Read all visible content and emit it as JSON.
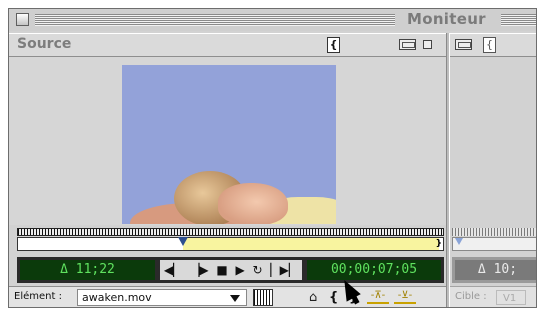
{
  "window": {
    "title": "Moniteur"
  },
  "source": {
    "title": "Source",
    "bracket_icon": "{",
    "duration": "Δ 11;22",
    "timecode": "00;00;07;05",
    "end_marker": "}",
    "clip_label": "Elément :",
    "clip_value": "awaken.mov",
    "mark_in": "⌂",
    "mark_bracket_in": "{",
    "mark_bracket_out": "}",
    "lift_icon": "-⊼-",
    "extract_icon": "-⊻-"
  },
  "transport": {
    "step_back": "◀▏",
    "step_fwd": "▕▶",
    "stop": "■",
    "play": "▶",
    "loop": "↻",
    "play_in_out": "▏▶▏"
  },
  "program": {
    "bracket_icon": "{",
    "duration": "Δ 10;",
    "target_label": "Cible :",
    "target_value": "V1"
  },
  "colors": {
    "timecode_bg": "#0b3a0b",
    "timecode_fg": "#5fe15f",
    "in_out_range": "#f8f49f",
    "playhead": "#2e4f8f",
    "video_bg": "#93a2d9"
  }
}
